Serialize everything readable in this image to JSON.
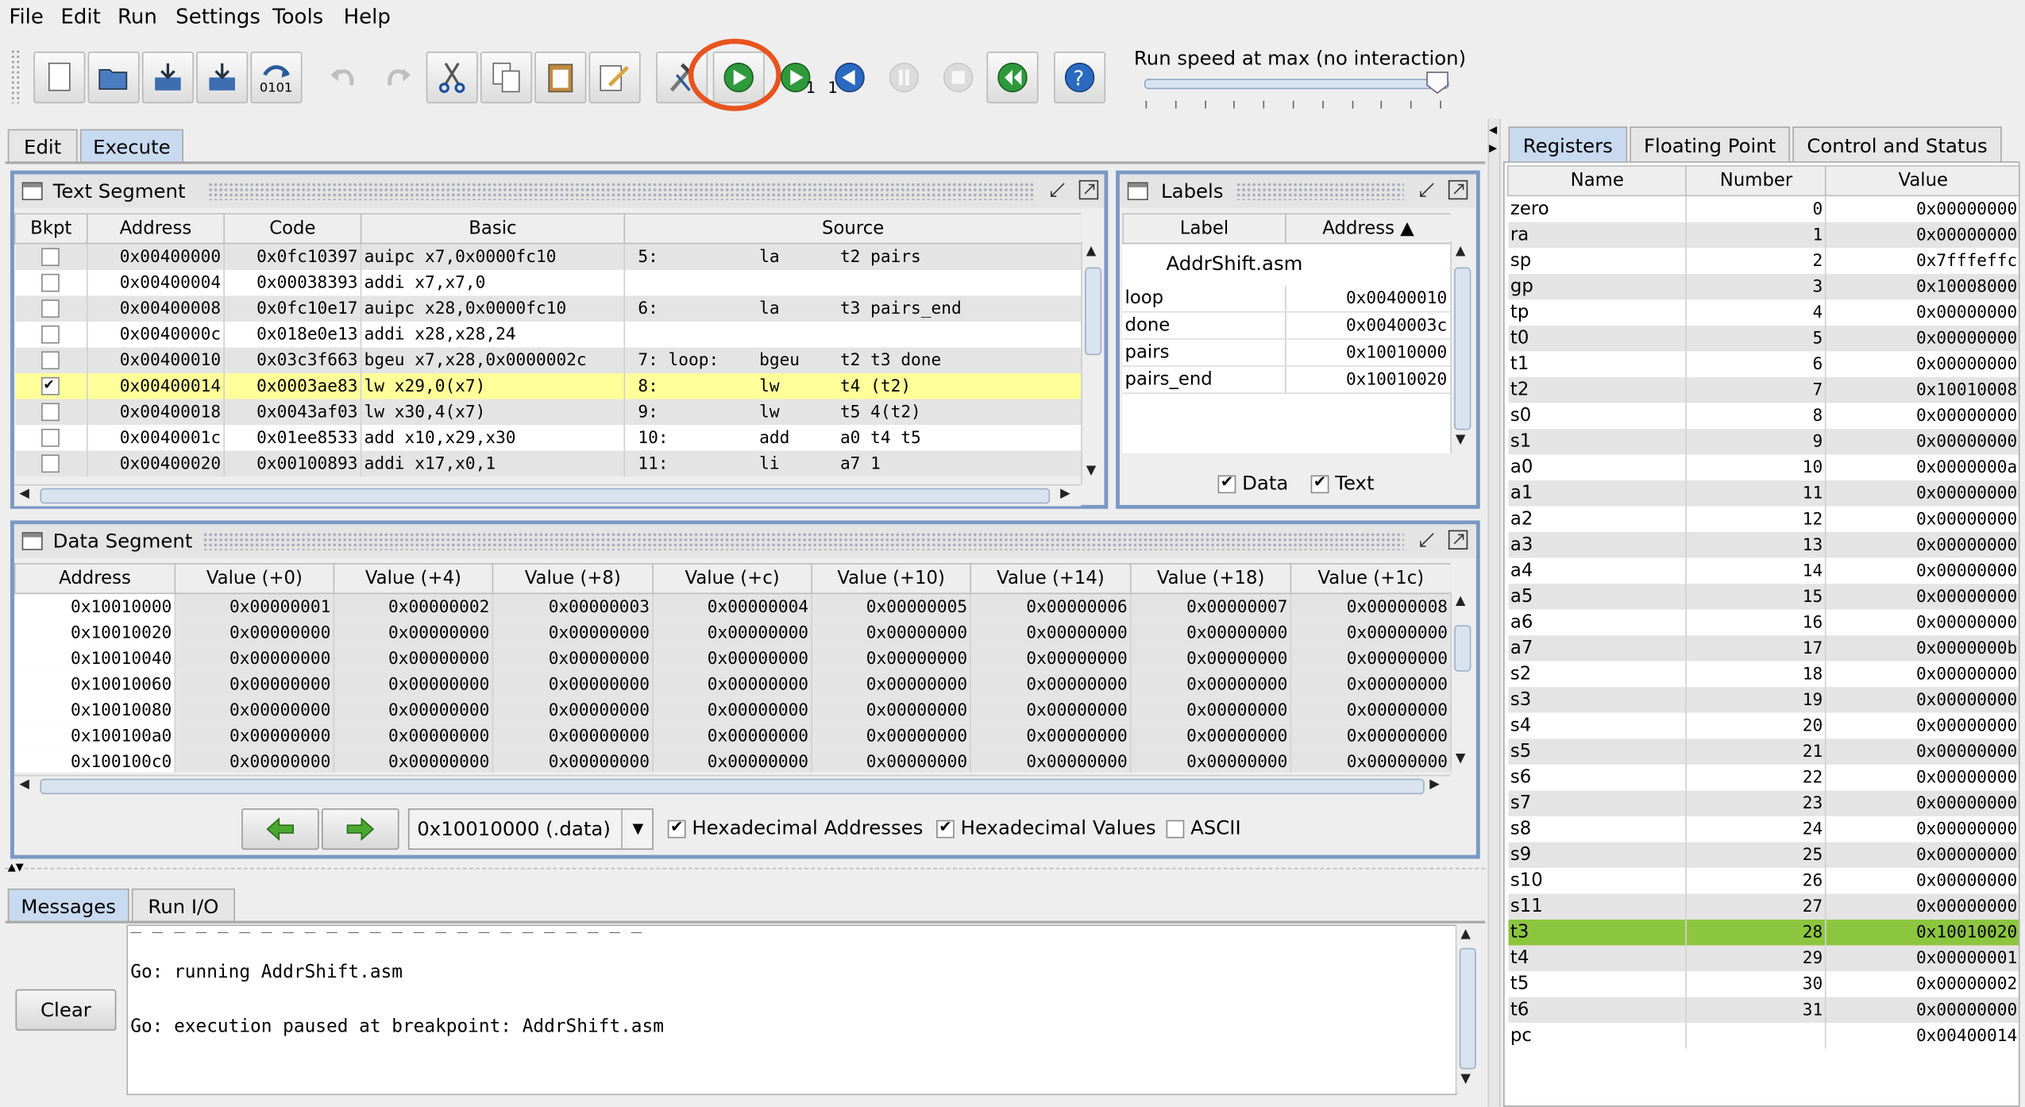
{
  "menu": [
    "File",
    "Edit",
    "Run",
    "Settings",
    "Tools",
    "Help"
  ],
  "toolbar": {
    "icons": [
      "new-file-icon",
      "open-file-icon",
      "save-icon",
      "save-as-icon",
      "dump-memory-icon",
      "undo-icon",
      "redo-icon",
      "cut-icon",
      "copy-icon",
      "paste-icon",
      "find-replace-icon",
      "assemble-icon",
      "run-icon",
      "step-icon",
      "backstep-icon",
      "pause-icon",
      "stop-icon",
      "reset-icon",
      "help-icon"
    ],
    "dump_sub": "0101",
    "step_sub": "1",
    "backstep_sub": "1",
    "highlight_color": "#e8541e"
  },
  "speed": {
    "label": "Run speed at max (no interaction)",
    "level": 1.0
  },
  "main_tabs": [
    "Edit",
    "Execute"
  ],
  "text_segment": {
    "title": "Text Segment",
    "headers": [
      "Bkpt",
      "Address",
      "Code",
      "Basic",
      "Source"
    ],
    "rows": [
      {
        "bkpt": false,
        "addr": "0x00400000",
        "code": "0x0fc10397",
        "basic": "auipc x7,0x0000fc10",
        "src": "5:          la      t2 pairs"
      },
      {
        "bkpt": false,
        "addr": "0x00400004",
        "code": "0x00038393",
        "basic": "addi x7,x7,0",
        "src": ""
      },
      {
        "bkpt": false,
        "addr": "0x00400008",
        "code": "0x0fc10e17",
        "basic": "auipc x28,0x0000fc10",
        "src": "6:          la      t3 pairs_end"
      },
      {
        "bkpt": false,
        "addr": "0x0040000c",
        "code": "0x018e0e13",
        "basic": "addi x28,x28,24",
        "src": ""
      },
      {
        "bkpt": false,
        "addr": "0x00400010",
        "code": "0x03c3f663",
        "basic": "bgeu x7,x28,0x0000002c",
        "src": "7: loop:    bgeu    t2 t3 done"
      },
      {
        "bkpt": true,
        "addr": "0x00400014",
        "code": "0x0003ae83",
        "basic": "lw x29,0(x7)",
        "src": "8:          lw      t4 (t2)"
      },
      {
        "bkpt": false,
        "addr": "0x00400018",
        "code": "0x0043af03",
        "basic": "lw x30,4(x7)",
        "src": "9:          lw      t5 4(t2)"
      },
      {
        "bkpt": false,
        "addr": "0x0040001c",
        "code": "0x01ee8533",
        "basic": "add x10,x29,x30",
        "src": "10:         add     a0 t4 t5"
      },
      {
        "bkpt": false,
        "addr": "0x00400020",
        "code": "0x00100893",
        "basic": "addi x17,x0,1",
        "src": "11:         li      a7 1"
      }
    ]
  },
  "labels": {
    "title": "Labels",
    "headers": [
      "Label",
      "Address ▲"
    ],
    "file": "AddrShift.asm",
    "rows": [
      {
        "label": "loop",
        "addr": "0x00400010"
      },
      {
        "label": "done",
        "addr": "0x0040003c"
      },
      {
        "label": "pairs",
        "addr": "0x10010000"
      },
      {
        "label": "pairs_end",
        "addr": "0x10010020"
      }
    ],
    "data_check": "Data",
    "text_check": "Text"
  },
  "data_segment": {
    "title": "Data Segment",
    "headers": [
      "Address",
      "Value (+0)",
      "Value (+4)",
      "Value (+8)",
      "Value (+c)",
      "Value (+10)",
      "Value (+14)",
      "Value (+18)",
      "Value (+1c)"
    ],
    "rows": [
      [
        "0x10010000",
        "0x00000001",
        "0x00000002",
        "0x00000003",
        "0x00000004",
        "0x00000005",
        "0x00000006",
        "0x00000007",
        "0x00000008"
      ],
      [
        "0x10010020",
        "0x00000000",
        "0x00000000",
        "0x00000000",
        "0x00000000",
        "0x00000000",
        "0x00000000",
        "0x00000000",
        "0x00000000"
      ],
      [
        "0x10010040",
        "0x00000000",
        "0x00000000",
        "0x00000000",
        "0x00000000",
        "0x00000000",
        "0x00000000",
        "0x00000000",
        "0x00000000"
      ],
      [
        "0x10010060",
        "0x00000000",
        "0x00000000",
        "0x00000000",
        "0x00000000",
        "0x00000000",
        "0x00000000",
        "0x00000000",
        "0x00000000"
      ],
      [
        "0x10010080",
        "0x00000000",
        "0x00000000",
        "0x00000000",
        "0x00000000",
        "0x00000000",
        "0x00000000",
        "0x00000000",
        "0x00000000"
      ],
      [
        "0x100100a0",
        "0x00000000",
        "0x00000000",
        "0x00000000",
        "0x00000000",
        "0x00000000",
        "0x00000000",
        "0x00000000",
        "0x00000000"
      ],
      [
        "0x100100c0",
        "0x00000000",
        "0x00000000",
        "0x00000000",
        "0x00000000",
        "0x00000000",
        "0x00000000",
        "0x00000000",
        "0x00000000"
      ]
    ],
    "segment_select": "0x10010000 (.data)",
    "hex_addresses": "Hexadecimal Addresses",
    "hex_values": "Hexadecimal Values",
    "ascii": "ASCII"
  },
  "messages": {
    "tabs": [
      "Messages",
      "Run I/O"
    ],
    "clear_label": "Clear",
    "lines": [
      "Go: running AddrShift.asm",
      "Go: execution paused at breakpoint: AddrShift.asm"
    ]
  },
  "registers": {
    "tabs": [
      "Registers",
      "Floating Point",
      "Control and Status"
    ],
    "headers": [
      "Name",
      "Number",
      "Value"
    ],
    "rows": [
      {
        "name": "zero",
        "num": "0",
        "val": "0x00000000"
      },
      {
        "name": "ra",
        "num": "1",
        "val": "0x00000000"
      },
      {
        "name": "sp",
        "num": "2",
        "val": "0x7fffeffc"
      },
      {
        "name": "gp",
        "num": "3",
        "val": "0x10008000"
      },
      {
        "name": "tp",
        "num": "4",
        "val": "0x00000000"
      },
      {
        "name": "t0",
        "num": "5",
        "val": "0x00000000"
      },
      {
        "name": "t1",
        "num": "6",
        "val": "0x00000000"
      },
      {
        "name": "t2",
        "num": "7",
        "val": "0x10010008"
      },
      {
        "name": "s0",
        "num": "8",
        "val": "0x00000000"
      },
      {
        "name": "s1",
        "num": "9",
        "val": "0x00000000"
      },
      {
        "name": "a0",
        "num": "10",
        "val": "0x0000000a"
      },
      {
        "name": "a1",
        "num": "11",
        "val": "0x00000000"
      },
      {
        "name": "a2",
        "num": "12",
        "val": "0x00000000"
      },
      {
        "name": "a3",
        "num": "13",
        "val": "0x00000000"
      },
      {
        "name": "a4",
        "num": "14",
        "val": "0x00000000"
      },
      {
        "name": "a5",
        "num": "15",
        "val": "0x00000000"
      },
      {
        "name": "a6",
        "num": "16",
        "val": "0x00000000"
      },
      {
        "name": "a7",
        "num": "17",
        "val": "0x0000000b"
      },
      {
        "name": "s2",
        "num": "18",
        "val": "0x00000000"
      },
      {
        "name": "s3",
        "num": "19",
        "val": "0x00000000"
      },
      {
        "name": "s4",
        "num": "20",
        "val": "0x00000000"
      },
      {
        "name": "s5",
        "num": "21",
        "val": "0x00000000"
      },
      {
        "name": "s6",
        "num": "22",
        "val": "0x00000000"
      },
      {
        "name": "s7",
        "num": "23",
        "val": "0x00000000"
      },
      {
        "name": "s8",
        "num": "24",
        "val": "0x00000000"
      },
      {
        "name": "s9",
        "num": "25",
        "val": "0x00000000"
      },
      {
        "name": "s10",
        "num": "26",
        "val": "0x00000000"
      },
      {
        "name": "s11",
        "num": "27",
        "val": "0x00000000"
      },
      {
        "name": "t3",
        "num": "28",
        "val": "0x10010020"
      },
      {
        "name": "t4",
        "num": "29",
        "val": "0x00000001"
      },
      {
        "name": "t5",
        "num": "30",
        "val": "0x00000002"
      },
      {
        "name": "t6",
        "num": "31",
        "val": "0x00000000"
      },
      {
        "name": "pc",
        "num": "",
        "val": "0x00400014"
      }
    ]
  }
}
